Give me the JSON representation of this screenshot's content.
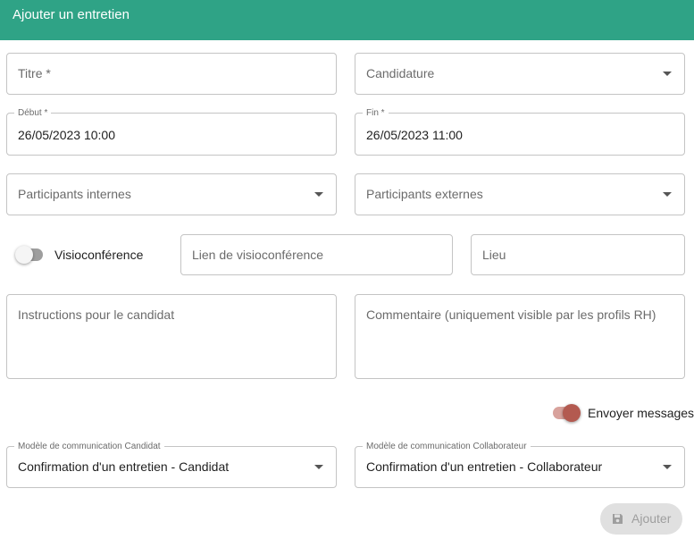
{
  "header": {
    "title": "Ajouter un entretien"
  },
  "form": {
    "titre": {
      "placeholder": "Titre *"
    },
    "candidature": {
      "placeholder": "Candidature"
    },
    "debut": {
      "label": "Début *",
      "value": "26/05/2023 10:00"
    },
    "fin": {
      "label": "Fin *",
      "value": "26/05/2023 11:00"
    },
    "participants_internes": {
      "placeholder": "Participants internes"
    },
    "participants_externes": {
      "placeholder": "Participants externes"
    },
    "visio": {
      "label": "Visioconférence",
      "checked": false
    },
    "lien_visio": {
      "placeholder": "Lien de visioconférence"
    },
    "lieu": {
      "placeholder": "Lieu"
    },
    "instructions": {
      "placeholder": "Instructions pour le candidat"
    },
    "commentaire": {
      "placeholder": "Commentaire (uniquement visible par les profils RH)"
    },
    "envoyer_messages": {
      "label": "Envoyer messages",
      "checked": true
    },
    "modele_candidat": {
      "label": "Modèle de communication Candidat",
      "value": "Confirmation d'un entretien - Candidat"
    },
    "modele_collaborateur": {
      "label": "Modèle de communication Collaborateur",
      "value": "Confirmation d'un entretien - Collaborateur"
    }
  },
  "actions": {
    "submit_label": "Ajouter",
    "submit_icon": "save-icon"
  },
  "colors": {
    "header": "#2fa386",
    "switch_on": "#b35a50"
  }
}
